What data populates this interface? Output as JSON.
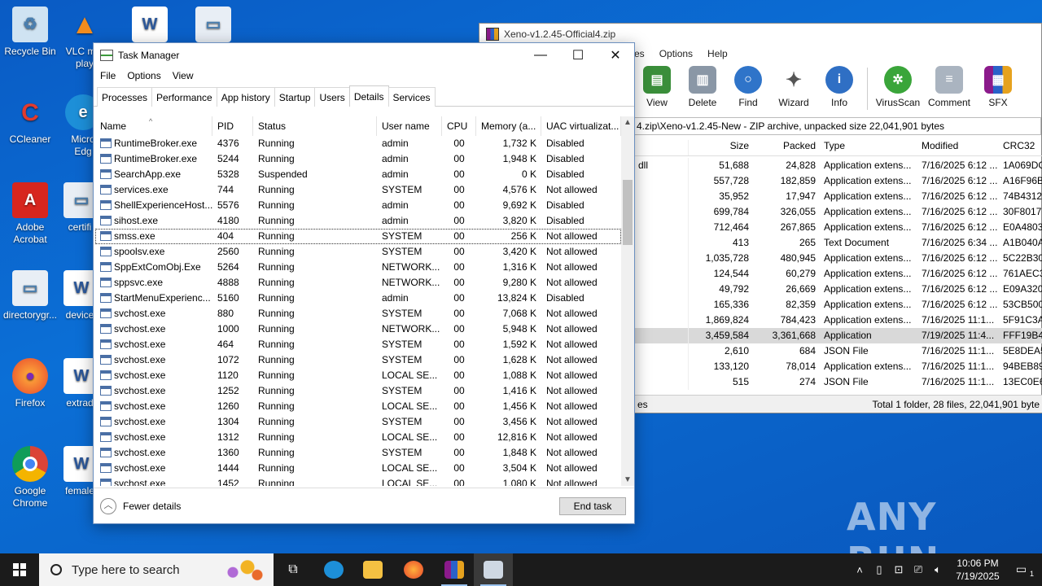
{
  "desktop_icons": [
    {
      "label": "Recycle Bin"
    },
    {
      "label": "VLC m... play"
    },
    {
      "label": ""
    },
    {
      "label": ""
    },
    {
      "label": "CCleaner"
    },
    {
      "label": "Micro Edg"
    },
    {
      "label": "Adobe Acrobat"
    },
    {
      "label": "certifi"
    },
    {
      "label": "directorygr..."
    },
    {
      "label": "device"
    },
    {
      "label": "Firefox"
    },
    {
      "label": "extrad"
    },
    {
      "label": "Google Chrome"
    },
    {
      "label": "female"
    }
  ],
  "winrar": {
    "title": "Xeno-v1.2.45-Official4.zip",
    "menu": [
      "es",
      "Options",
      "Help"
    ],
    "tools": [
      "View",
      "Delete",
      "Find",
      "Wizard",
      "Info",
      "VirusScan",
      "Comment",
      "SFX"
    ],
    "path": "4.zip\\Xeno-v1.2.45-New - ZIP archive, unpacked size 22,041,901 bytes",
    "columns": [
      "",
      "Size",
      "Packed",
      "Type",
      "Modified",
      "CRC32"
    ],
    "rows": [
      {
        "name": "dll",
        "size": "51,688",
        "packed": "24,828",
        "type": "Application extens...",
        "modified": "7/16/2025 6:12 ...",
        "crc": "1A069DC"
      },
      {
        "name": "",
        "size": "557,728",
        "packed": "182,859",
        "type": "Application extens...",
        "modified": "7/16/2025 6:12 ...",
        "crc": "A16F96B"
      },
      {
        "name": "",
        "size": "35,952",
        "packed": "17,947",
        "type": "Application extens...",
        "modified": "7/16/2025 6:12 ...",
        "crc": "74B4312"
      },
      {
        "name": "",
        "size": "699,784",
        "packed": "326,055",
        "type": "Application extens...",
        "modified": "7/16/2025 6:12 ...",
        "crc": "30F8017"
      },
      {
        "name": "",
        "size": "712,464",
        "packed": "267,865",
        "type": "Application extens...",
        "modified": "7/16/2025 6:12 ...",
        "crc": "E0A4803"
      },
      {
        "name": "",
        "size": "413",
        "packed": "265",
        "type": "Text Document",
        "modified": "7/16/2025 6:34 ...",
        "crc": "A1B040A"
      },
      {
        "name": "",
        "size": "1,035,728",
        "packed": "480,945",
        "type": "Application extens...",
        "modified": "7/16/2025 6:12 ...",
        "crc": "5C22B30"
      },
      {
        "name": "",
        "size": "124,544",
        "packed": "60,279",
        "type": "Application extens...",
        "modified": "7/16/2025 6:12 ...",
        "crc": "761AEC3"
      },
      {
        "name": "",
        "size": "49,792",
        "packed": "26,669",
        "type": "Application extens...",
        "modified": "7/16/2025 6:12 ...",
        "crc": "E09A320"
      },
      {
        "name": "",
        "size": "165,336",
        "packed": "82,359",
        "type": "Application extens...",
        "modified": "7/16/2025 6:12 ...",
        "crc": "53CB500"
      },
      {
        "name": "",
        "size": "1,869,824",
        "packed": "784,423",
        "type": "Application extens...",
        "modified": "7/16/2025 11:1...",
        "crc": "5F91C3A"
      },
      {
        "name": "",
        "size": "3,459,584",
        "packed": "3,361,668",
        "type": "Application",
        "modified": "7/19/2025 11:4...",
        "crc": "FFF19B4"
      },
      {
        "name": "",
        "size": "2,610",
        "packed": "684",
        "type": "JSON File",
        "modified": "7/16/2025 11:1...",
        "crc": "5E8DEA5"
      },
      {
        "name": "",
        "size": "133,120",
        "packed": "78,014",
        "type": "Application extens...",
        "modified": "7/16/2025 11:1...",
        "crc": "94BEB89"
      },
      {
        "name": "",
        "size": "515",
        "packed": "274",
        "type": "JSON File",
        "modified": "7/16/2025 11:1...",
        "crc": "13EC0E6"
      }
    ],
    "status_left": "es",
    "status_right": "Total 1 folder, 28 files, 22,041,901 byte"
  },
  "taskmgr": {
    "title": "Task Manager",
    "menu": [
      "File",
      "Options",
      "View"
    ],
    "tabs": [
      "Processes",
      "Performance",
      "App history",
      "Startup",
      "Users",
      "Details",
      "Services"
    ],
    "active_tab": "Details",
    "columns": [
      "Name",
      "PID",
      "Status",
      "User name",
      "CPU",
      "Memory (a...",
      "UAC virtualizat..."
    ],
    "rows": [
      {
        "name": "RuntimeBroker.exe",
        "pid": "4376",
        "status": "Running",
        "user": "admin",
        "cpu": "00",
        "mem": "1,732 K",
        "uac": "Disabled"
      },
      {
        "name": "RuntimeBroker.exe",
        "pid": "5244",
        "status": "Running",
        "user": "admin",
        "cpu": "00",
        "mem": "1,948 K",
        "uac": "Disabled"
      },
      {
        "name": "SearchApp.exe",
        "pid": "5328",
        "status": "Suspended",
        "user": "admin",
        "cpu": "00",
        "mem": "0 K",
        "uac": "Disabled"
      },
      {
        "name": "services.exe",
        "pid": "744",
        "status": "Running",
        "user": "SYSTEM",
        "cpu": "00",
        "mem": "4,576 K",
        "uac": "Not allowed"
      },
      {
        "name": "ShellExperienceHost....",
        "pid": "5576",
        "status": "Running",
        "user": "admin",
        "cpu": "00",
        "mem": "9,692 K",
        "uac": "Disabled"
      },
      {
        "name": "sihost.exe",
        "pid": "4180",
        "status": "Running",
        "user": "admin",
        "cpu": "00",
        "mem": "3,820 K",
        "uac": "Disabled"
      },
      {
        "name": "smss.exe",
        "pid": "404",
        "status": "Running",
        "user": "SYSTEM",
        "cpu": "00",
        "mem": "256 K",
        "uac": "Not allowed"
      },
      {
        "name": "spoolsv.exe",
        "pid": "2560",
        "status": "Running",
        "user": "SYSTEM",
        "cpu": "00",
        "mem": "3,420 K",
        "uac": "Not allowed"
      },
      {
        "name": "SppExtComObj.Exe",
        "pid": "5264",
        "status": "Running",
        "user": "NETWORK...",
        "cpu": "00",
        "mem": "1,316 K",
        "uac": "Not allowed"
      },
      {
        "name": "sppsvc.exe",
        "pid": "4888",
        "status": "Running",
        "user": "NETWORK...",
        "cpu": "00",
        "mem": "9,280 K",
        "uac": "Not allowed"
      },
      {
        "name": "StartMenuExperienc...",
        "pid": "5160",
        "status": "Running",
        "user": "admin",
        "cpu": "00",
        "mem": "13,824 K",
        "uac": "Disabled"
      },
      {
        "name": "svchost.exe",
        "pid": "880",
        "status": "Running",
        "user": "SYSTEM",
        "cpu": "00",
        "mem": "7,068 K",
        "uac": "Not allowed"
      },
      {
        "name": "svchost.exe",
        "pid": "1000",
        "status": "Running",
        "user": "NETWORK...",
        "cpu": "00",
        "mem": "5,948 K",
        "uac": "Not allowed"
      },
      {
        "name": "svchost.exe",
        "pid": "464",
        "status": "Running",
        "user": "SYSTEM",
        "cpu": "00",
        "mem": "1,592 K",
        "uac": "Not allowed"
      },
      {
        "name": "svchost.exe",
        "pid": "1072",
        "status": "Running",
        "user": "SYSTEM",
        "cpu": "00",
        "mem": "1,628 K",
        "uac": "Not allowed"
      },
      {
        "name": "svchost.exe",
        "pid": "1120",
        "status": "Running",
        "user": "LOCAL SE...",
        "cpu": "00",
        "mem": "1,088 K",
        "uac": "Not allowed"
      },
      {
        "name": "svchost.exe",
        "pid": "1252",
        "status": "Running",
        "user": "SYSTEM",
        "cpu": "00",
        "mem": "1,416 K",
        "uac": "Not allowed"
      },
      {
        "name": "svchost.exe",
        "pid": "1260",
        "status": "Running",
        "user": "LOCAL SE...",
        "cpu": "00",
        "mem": "1,456 K",
        "uac": "Not allowed"
      },
      {
        "name": "svchost.exe",
        "pid": "1304",
        "status": "Running",
        "user": "SYSTEM",
        "cpu": "00",
        "mem": "3,456 K",
        "uac": "Not allowed"
      },
      {
        "name": "svchost.exe",
        "pid": "1312",
        "status": "Running",
        "user": "LOCAL SE...",
        "cpu": "00",
        "mem": "12,816 K",
        "uac": "Not allowed"
      },
      {
        "name": "svchost.exe",
        "pid": "1360",
        "status": "Running",
        "user": "SYSTEM",
        "cpu": "00",
        "mem": "1,848 K",
        "uac": "Not allowed"
      },
      {
        "name": "svchost.exe",
        "pid": "1444",
        "status": "Running",
        "user": "LOCAL SE...",
        "cpu": "00",
        "mem": "3,504 K",
        "uac": "Not allowed"
      },
      {
        "name": "svchost.exe",
        "pid": "1452",
        "status": "Running",
        "user": "LOCAL SE...",
        "cpu": "00",
        "mem": "1,080 K",
        "uac": "Not allowed"
      }
    ],
    "selected_row": 6,
    "fewer_details": "Fewer details",
    "end_task": "End task"
  },
  "watermark": "ANY RUN",
  "taskbar": {
    "search_placeholder": "Type here to search",
    "time": "10:06 PM",
    "date": "7/19/2025",
    "notification_count": "1"
  },
  "colors": {
    "desktop": "#0b6fd6",
    "taskbar": "#1b1b1b",
    "accent": "#0078d7"
  }
}
